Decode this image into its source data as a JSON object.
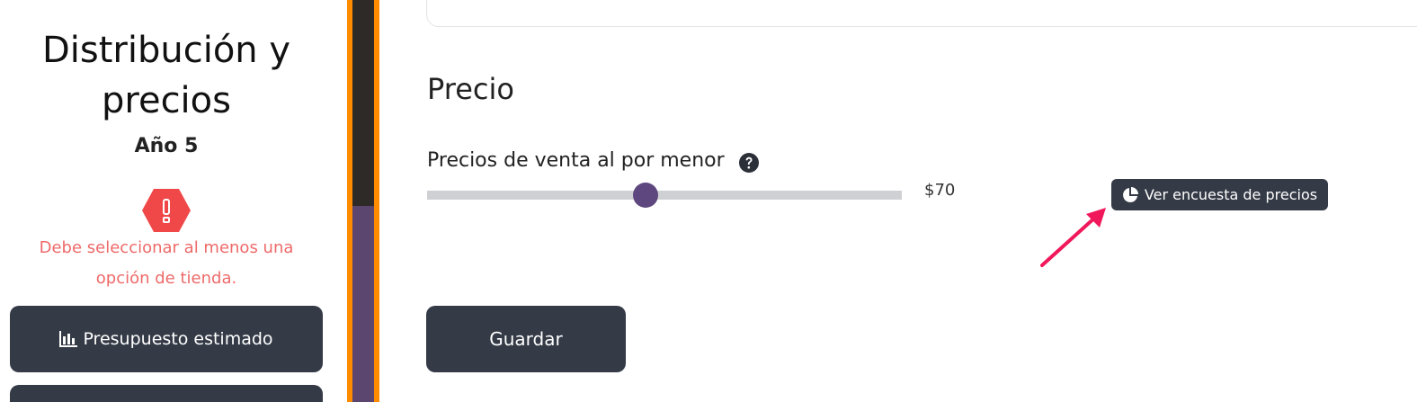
{
  "sidebar": {
    "title": "Distribución y precios",
    "year": "Año 5",
    "warning": "Debe seleccionar al menos una opción de tienda.",
    "budget_button": "Presupuesto estimado"
  },
  "main": {
    "section_title": "Precio",
    "retail_label": "Precios de venta al por menor",
    "price_value": "$70",
    "survey_button": "Ver encuesta de precios",
    "save_button": "Guardar"
  },
  "slider": {
    "level_fraction": 0.46
  },
  "colors": {
    "dark_button": "#343a46",
    "warning": "#ee6a6a",
    "warning_icon": "#f04848",
    "slider_thumb": "#5e467e",
    "annotation_arrow": "#f0185a",
    "accent_strip": "#ff8c00"
  },
  "icons": {
    "warning": "exclamation-hexagon-icon",
    "budget": "bar-chart-icon",
    "help": "question-circle-icon",
    "survey": "pie-chart-icon",
    "annotation": "arrow-icon"
  }
}
